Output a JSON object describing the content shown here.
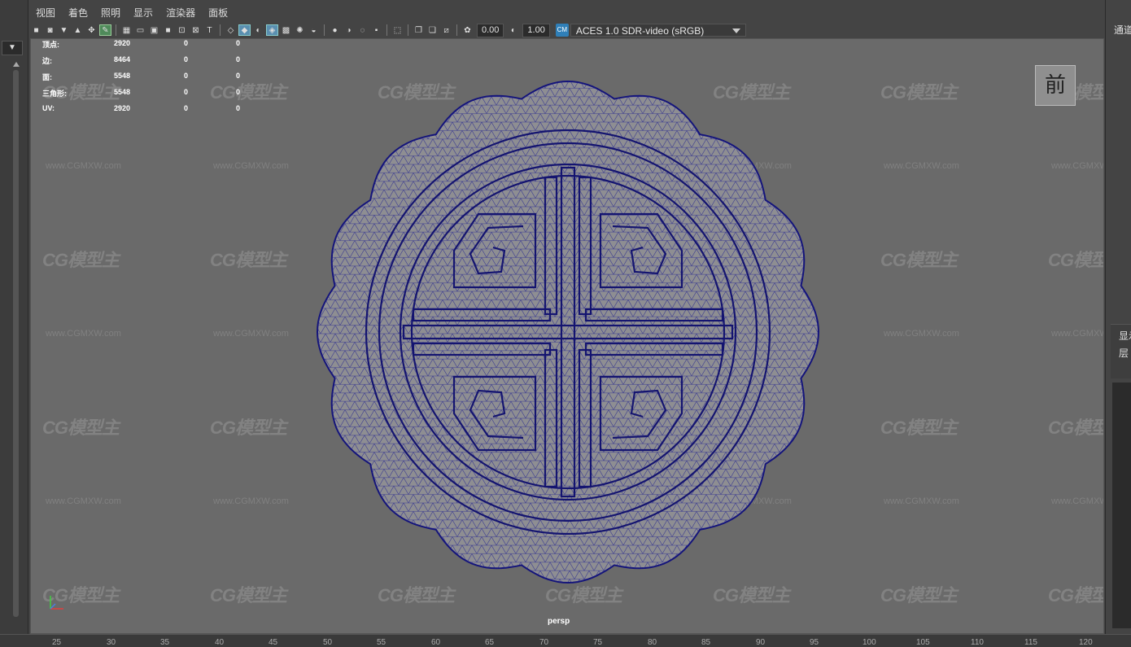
{
  "menubar": {
    "items": [
      "视图",
      "着色",
      "照明",
      "显示",
      "渲染器",
      "面板"
    ]
  },
  "toolbar": {
    "exposure_value": "0.00",
    "gamma_value": "1.00",
    "color_space": "ACES 1.0 SDR-video (sRGB)"
  },
  "hud": {
    "rows": [
      {
        "label": "顶点:",
        "v1": "2920",
        "v2": "0",
        "v3": "0"
      },
      {
        "label": "边:",
        "v1": "8464",
        "v2": "0",
        "v3": "0"
      },
      {
        "label": "面:",
        "v1": "5548",
        "v2": "0",
        "v3": "0"
      },
      {
        "label": "三角形:",
        "v1": "5548",
        "v2": "0",
        "v3": "0"
      },
      {
        "label": "UV:",
        "v1": "2920",
        "v2": "0",
        "v3": "0"
      }
    ]
  },
  "viewport": {
    "camera_label": "persp",
    "view_cube_label": "前"
  },
  "watermark": {
    "logo": "CG模型主",
    "url": "www.CGMXW.com"
  },
  "right_panel": {
    "channel_label": "通道",
    "display_label": "显示",
    "layer_label": "层"
  },
  "timeline": {
    "ticks": [
      "25",
      "30",
      "35",
      "40",
      "45",
      "50",
      "55",
      "60",
      "65",
      "70",
      "75",
      "80",
      "85",
      "90",
      "95",
      "100",
      "105",
      "110",
      "115",
      "120"
    ]
  },
  "colors": {
    "viewport_bg": "#6a6a6a",
    "wire": "#1a1a8c",
    "mesh": "#8e8e90",
    "accent": "#5a8fb0"
  }
}
